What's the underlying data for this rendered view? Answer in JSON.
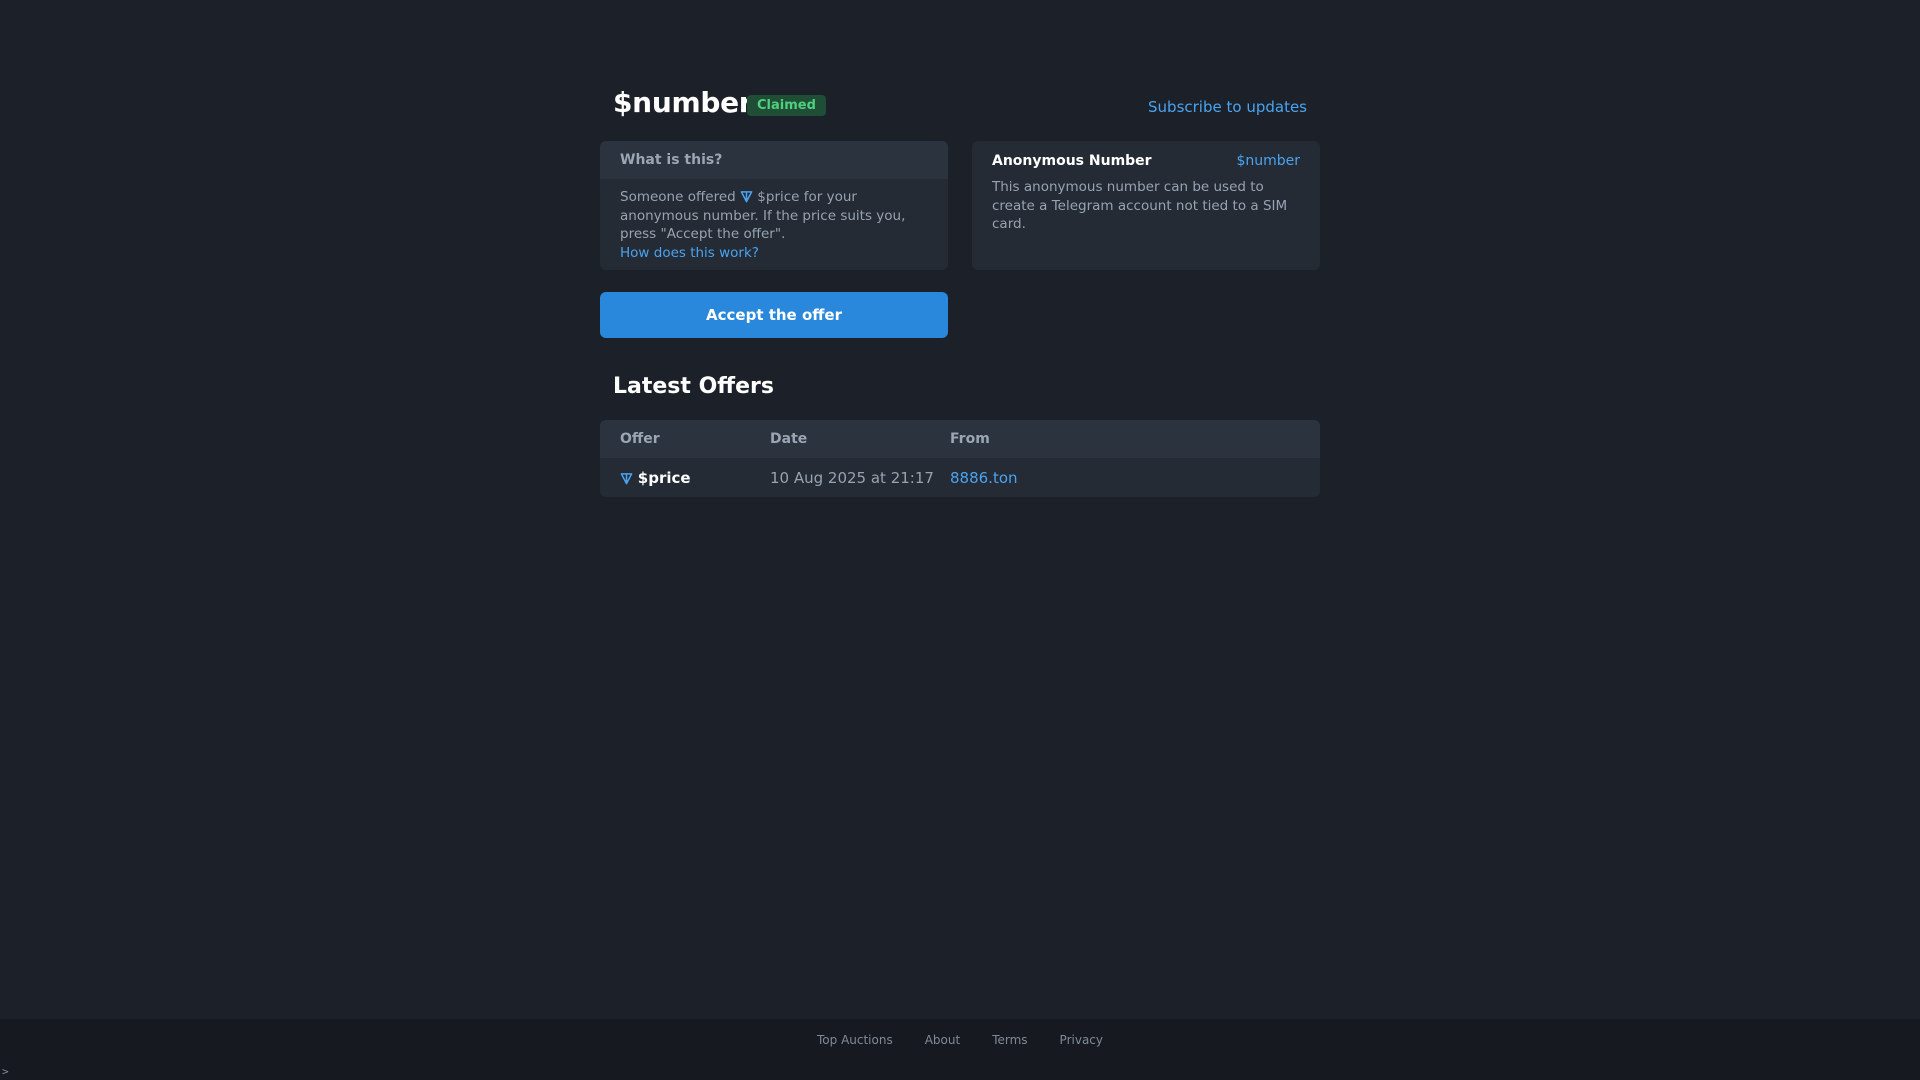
{
  "header": {
    "title": "$number",
    "status_badge": "Claimed",
    "subscribe_link": "Subscribe to updates"
  },
  "info_card": {
    "heading": "What is this?",
    "text_before": "Someone offered ",
    "price": "$price",
    "text_after": " for your anonymous number. If the price suits you, press \"Accept the offer\".",
    "how_link": "How does this work?",
    "currency_icon": "ton-icon"
  },
  "anon_card": {
    "title": "Anonymous Number",
    "number": "$number",
    "description": "This anonymous number can be used to create a Telegram account not tied to a SIM card."
  },
  "accept_button": "Accept the offer",
  "latest_offers": {
    "title": "Latest Offers",
    "columns": [
      "Offer",
      "Date",
      "From"
    ],
    "rows": [
      {
        "offer": "$price",
        "date": "10 Aug 2025 at 21:17",
        "from": "8886.ton"
      }
    ]
  },
  "footer": {
    "links": [
      "Top Auctions",
      "About",
      "Terms",
      "Privacy"
    ],
    "prompt": ">"
  },
  "colors": {
    "background": "#1c2129",
    "card": "#242b35",
    "accent": "#2a88dc",
    "link": "#4aa3ef",
    "badge_bg": "#1f4d35",
    "badge_text": "#4fd07f"
  }
}
